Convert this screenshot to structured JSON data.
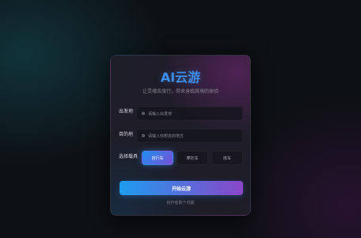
{
  "app": {
    "title": "AI云游",
    "subtitle": "让灵魂去旅行，带来身临其境的体验"
  },
  "form": {
    "origin": {
      "label": "出发地",
      "placeholder": "请输入出发地"
    },
    "destination": {
      "label": "目的地",
      "placeholder": "请输入你想去的地方"
    },
    "vehicle": {
      "label": "选择载具",
      "options": [
        "自行车",
        "摩托车",
        "房车"
      ],
      "selected": "自行车"
    }
  },
  "actions": {
    "start_label": "开始云游",
    "footer_note": "给作者助个鸡腿"
  },
  "colors": {
    "accent": "#3d8eea",
    "button_start": "#1e9cf0",
    "button_end": "#8a46c8"
  }
}
